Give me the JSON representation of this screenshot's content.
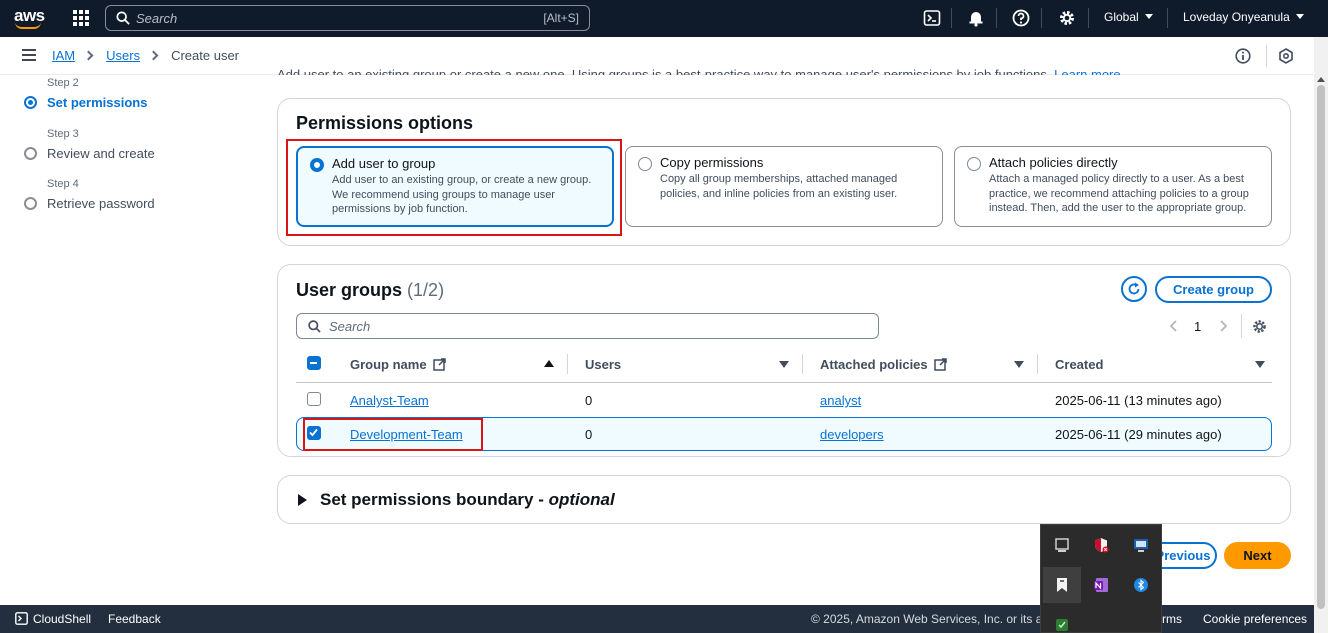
{
  "topnav": {
    "logo_text": "aws",
    "search_placeholder": "Search",
    "search_shortcut": "[Alt+S]",
    "region": "Global",
    "account": "Loveday Onyeanula"
  },
  "breadcrumb": {
    "items": [
      "IAM",
      "Users"
    ],
    "current": "Create user"
  },
  "intro_text": "Add user to an existing group or create a new one. Using groups is a best-practice way to manage user's permissions by job functions.",
  "intro_link": "Learn more",
  "steps": [
    {
      "label": "Step 2",
      "title": "Set permissions",
      "state": "active"
    },
    {
      "label": "Step 3",
      "title": "Review and create",
      "state": "pending"
    },
    {
      "label": "Step 4",
      "title": "Retrieve password",
      "state": "pending"
    }
  ],
  "permissions": {
    "heading": "Permissions options",
    "options": [
      {
        "title": "Add user to group",
        "desc": "Add user to an existing group, or create a new group. We recommend using groups to manage user permissions by job function.",
        "selected": true
      },
      {
        "title": "Copy permissions",
        "desc": "Copy all group memberships, attached managed policies, and inline policies from an existing user.",
        "selected": false
      },
      {
        "title": "Attach policies directly",
        "desc": "Attach a managed policy directly to a user. As a best practice, we recommend attaching policies to a group instead. Then, add the user to the appropriate group.",
        "selected": false
      }
    ]
  },
  "groups": {
    "heading": "User groups",
    "count": "(1/2)",
    "create_button": "Create group",
    "search_placeholder": "Search",
    "page": "1",
    "columns": [
      "Group name",
      "Users",
      "Attached policies",
      "Created"
    ],
    "rows": [
      {
        "name": "Analyst-Team",
        "users": "0",
        "policy": "analyst",
        "created": "2025-06-11 (13 minutes ago)",
        "checked": false
      },
      {
        "name": "Development-Team",
        "users": "0",
        "policy": "developers",
        "created": "2025-06-11 (29 minutes ago)",
        "checked": true
      }
    ]
  },
  "boundary": {
    "title": "Set permissions boundary",
    "optional": "optional"
  },
  "actions": {
    "previous": "Previous",
    "previous_visible": "evious",
    "next": "Next"
  },
  "footer": {
    "cloudshell": "CloudShell",
    "feedback": "Feedback",
    "copyright": "© 2025, Amazon Web Services, Inc. or its affili",
    "terms": "rms",
    "cookie": "Cookie preferences"
  },
  "colors": {
    "nav_bg": "#0f1b2a",
    "link": "#0972d3",
    "primary": "#ff9900",
    "highlight_box": "#d91515"
  }
}
